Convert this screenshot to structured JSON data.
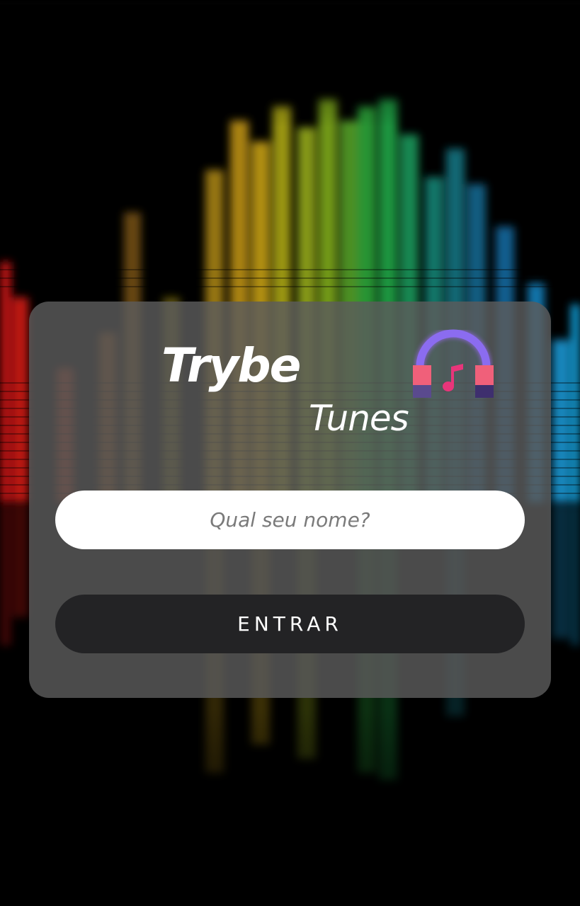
{
  "app": {
    "brand_primary": "Trybe",
    "brand_secondary": "Tunes",
    "logo_icon": "headphones-music-note-icon"
  },
  "login": {
    "name_placeholder": "Qual seu nome?",
    "name_value": "",
    "submit_label": "ENTRAR"
  },
  "theme": {
    "card_background": "#5c5c5c",
    "button_background": "#232325",
    "input_background": "#ffffff",
    "headphones_band": "#8b6cf0",
    "headphones_cup": "#f0607a",
    "note_color": "#e8357a"
  }
}
